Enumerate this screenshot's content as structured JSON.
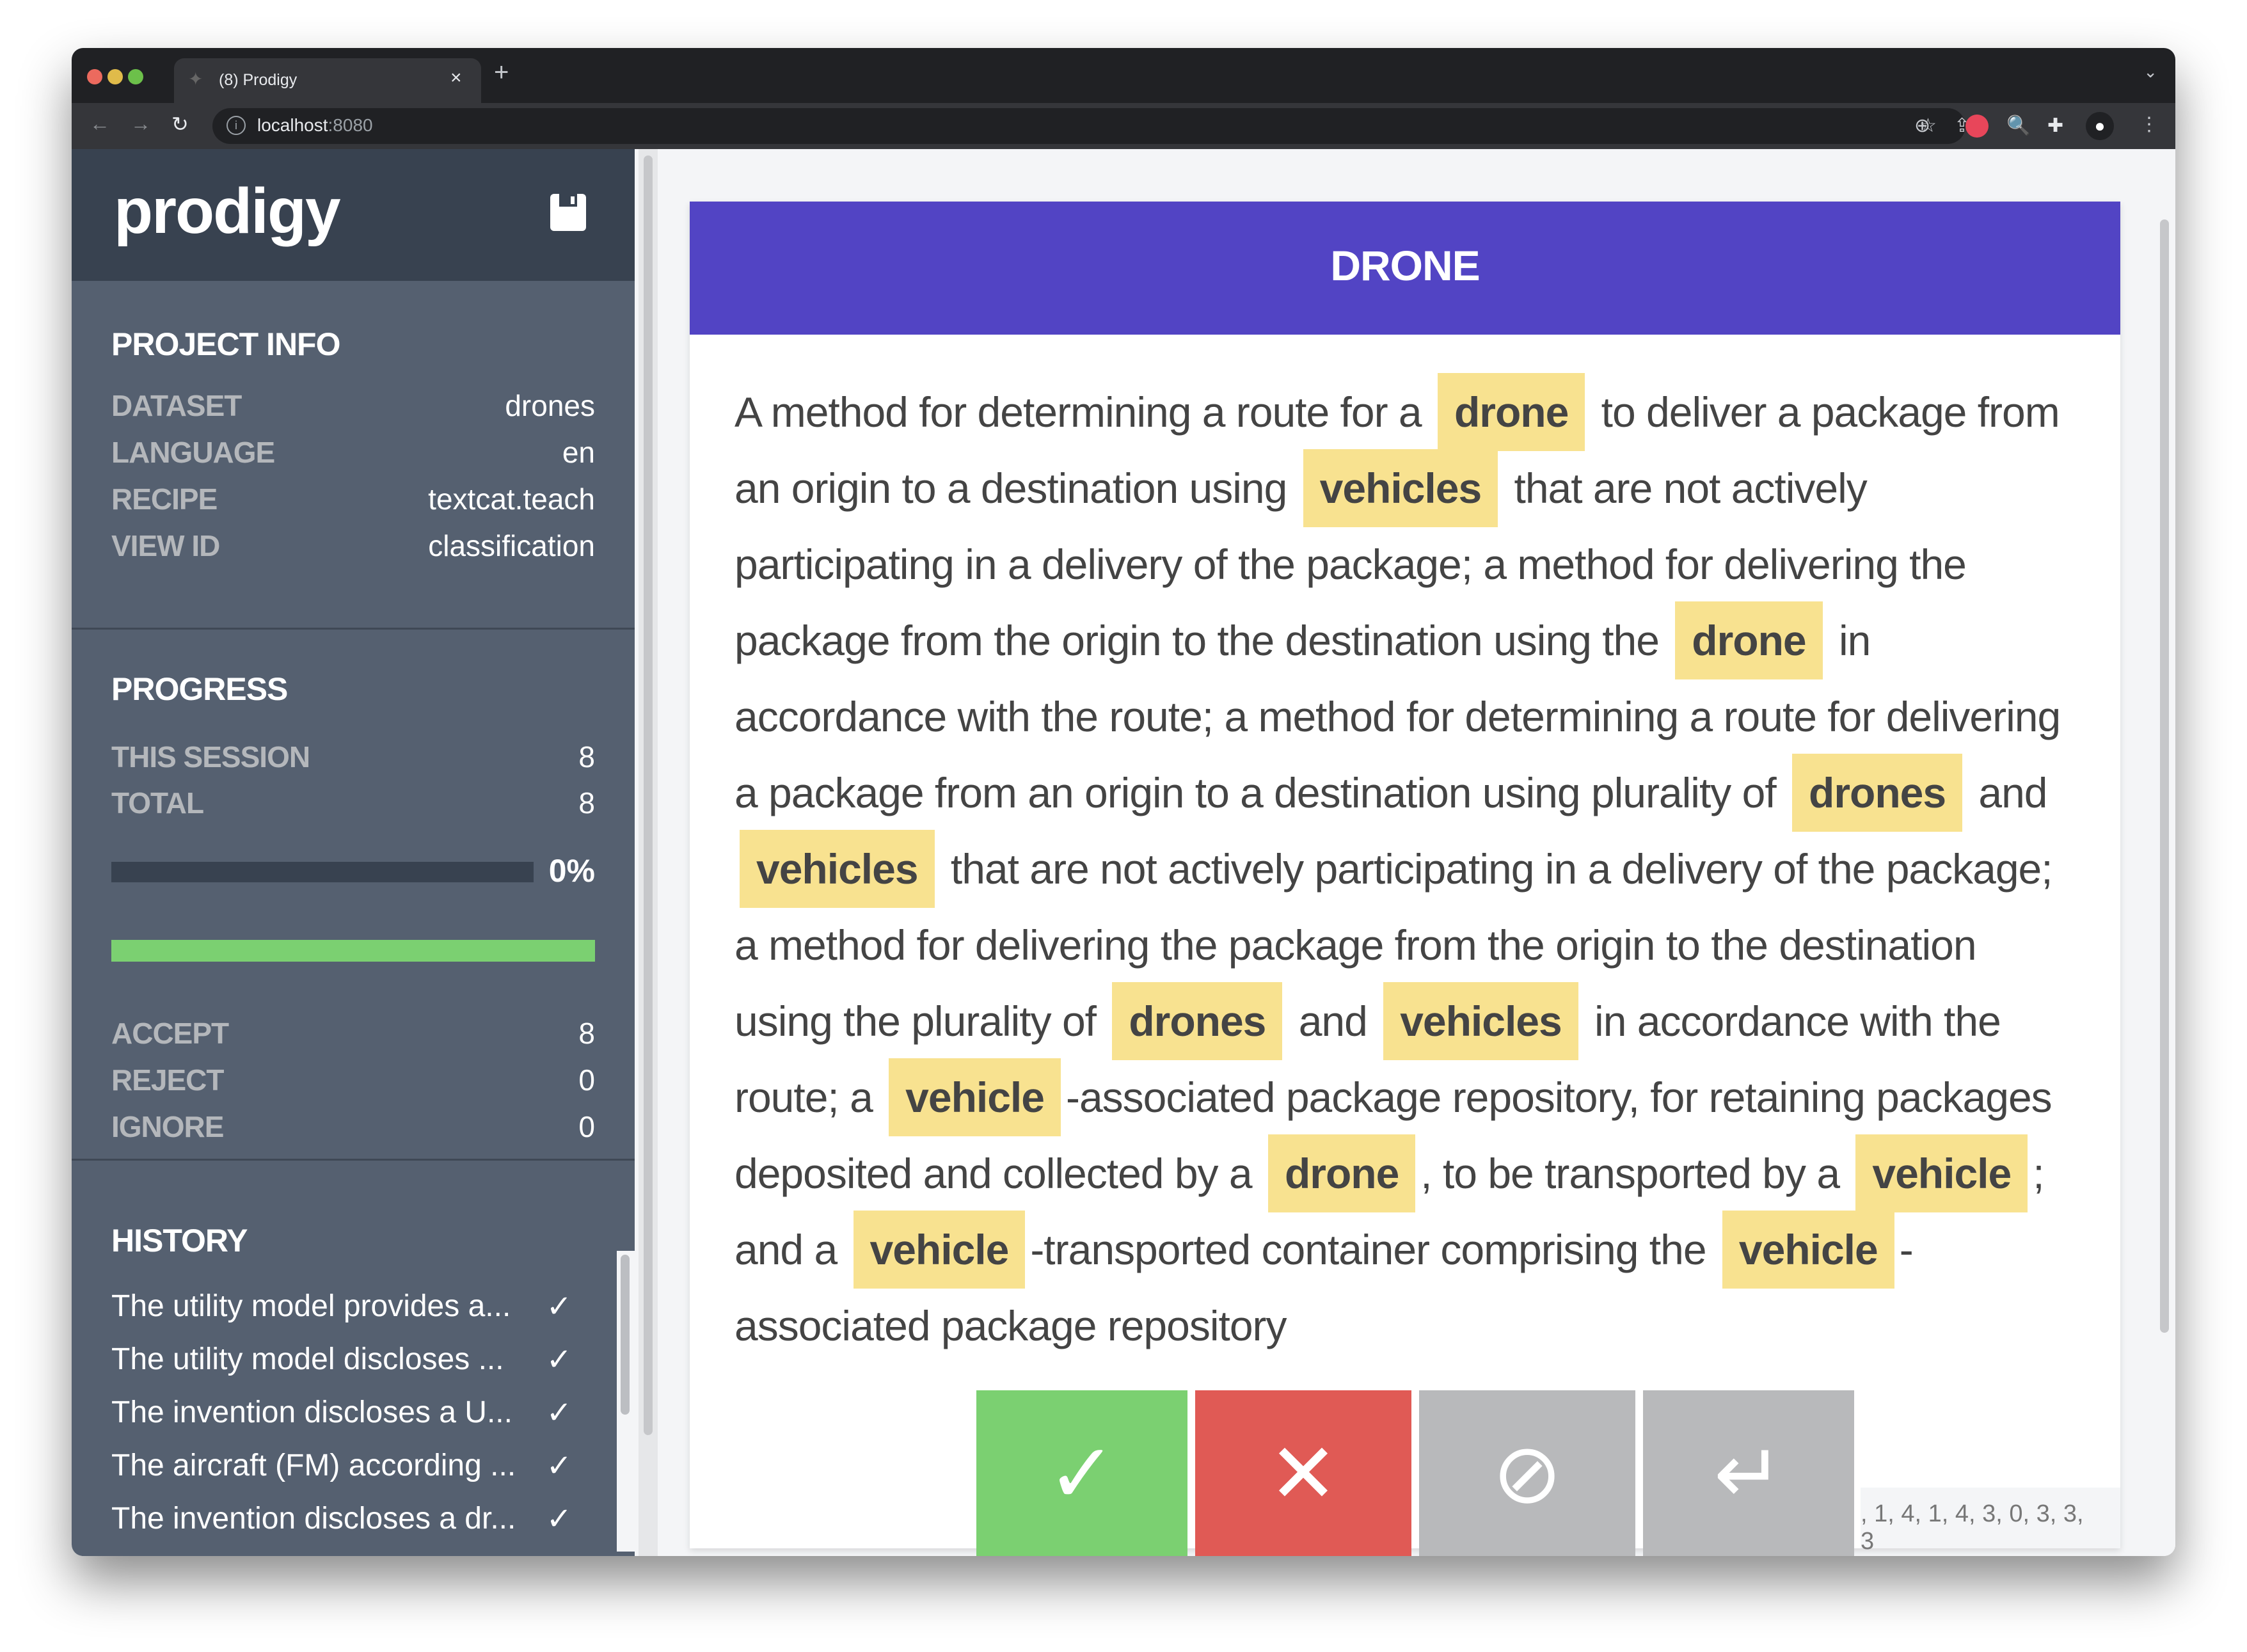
{
  "browser": {
    "tab_title": "(8) Prodigy",
    "tab_close": "×",
    "new_tab": "+",
    "url_host": "localhost",
    "url_port": ":8080",
    "icons": [
      "back-arrow",
      "forward-arrow",
      "reload",
      "site-info",
      "zoom",
      "share",
      "bookmark-star",
      "extension-red",
      "extension-magnifier",
      "extensions-puzzle",
      "profile",
      "menu-kebab"
    ]
  },
  "sidebar": {
    "logo": "prodigy",
    "project_info": {
      "title": "PROJECT INFO",
      "rows": [
        {
          "key": "DATASET",
          "value": "drones"
        },
        {
          "key": "LANGUAGE",
          "value": "en"
        },
        {
          "key": "RECIPE",
          "value": "textcat.teach"
        },
        {
          "key": "VIEW ID",
          "value": "classification"
        }
      ]
    },
    "progress": {
      "title": "PROGRESS",
      "this_session_label": "THIS SESSION",
      "this_session": "8",
      "total_label": "TOTAL",
      "total": "8",
      "percent_label": "0%",
      "percent": 0,
      "accept_label": "ACCEPT",
      "accept": "8",
      "reject_label": "REJECT",
      "reject": "0",
      "ignore_label": "IGNORE",
      "ignore": "0"
    },
    "history": {
      "title": "HISTORY",
      "items": [
        {
          "text": "The utility model provides a...",
          "status": "✓"
        },
        {
          "text": "The utility model discloses ...",
          "status": "✓"
        },
        {
          "text": "The invention discloses a U...",
          "status": "✓"
        },
        {
          "text": "The aircraft (FM) according ...",
          "status": "✓"
        },
        {
          "text": "The invention discloses a dr...",
          "status": "✓"
        }
      ]
    }
  },
  "card": {
    "label": "DRONE",
    "segments": [
      {
        "t": "A method for determining a route for a "
      },
      {
        "t": "drone",
        "hl": true
      },
      {
        "t": " to deliver a package from an origin to a destination using "
      },
      {
        "t": "vehicles",
        "hl": true
      },
      {
        "t": " that are not actively participating in a delivery of the package; a method for delivering the package from the origin to the destination using the "
      },
      {
        "t": "drone",
        "hl": true
      },
      {
        "t": " in accordance with the route; a method for determining a route for delivering a package from an origin to a destination using plurality of "
      },
      {
        "t": "drones",
        "hl": true
      },
      {
        "t": " and "
      },
      {
        "t": "vehicles",
        "hl": true
      },
      {
        "t": " that are not actively participating in a delivery of the package; a method for delivering the package from the origin to the destination using the plurality of "
      },
      {
        "t": "drones",
        "hl": true
      },
      {
        "t": " and "
      },
      {
        "t": "vehicles",
        "hl": true
      },
      {
        "t": " in accordance with the route; a "
      },
      {
        "t": "vehicle",
        "hl": true
      },
      {
        "t": "-associated package repository, for retaining packages deposited and collected by a "
      },
      {
        "t": "drone",
        "hl": true
      },
      {
        "t": ", to be transported by a "
      },
      {
        "t": "vehicle",
        "hl": true
      },
      {
        "t": "; and a "
      },
      {
        "t": "vehicle",
        "hl": true
      },
      {
        "t": "-transported container comprising the "
      },
      {
        "t": "vehicle",
        "hl": true
      },
      {
        "t": "-associated package repository"
      }
    ],
    "meta": ", 1, 4, 1, 4, 3, 0, 3, 3, 3"
  },
  "actions": {
    "accept": "✓",
    "reject": "✕",
    "ignore": "⊘",
    "undo": "↵"
  },
  "colors": {
    "accent": "#5244c4",
    "accept": "#7bd071",
    "reject": "#e05a55",
    "ignore": "#b8b9bb",
    "highlight": "#f8e290"
  }
}
